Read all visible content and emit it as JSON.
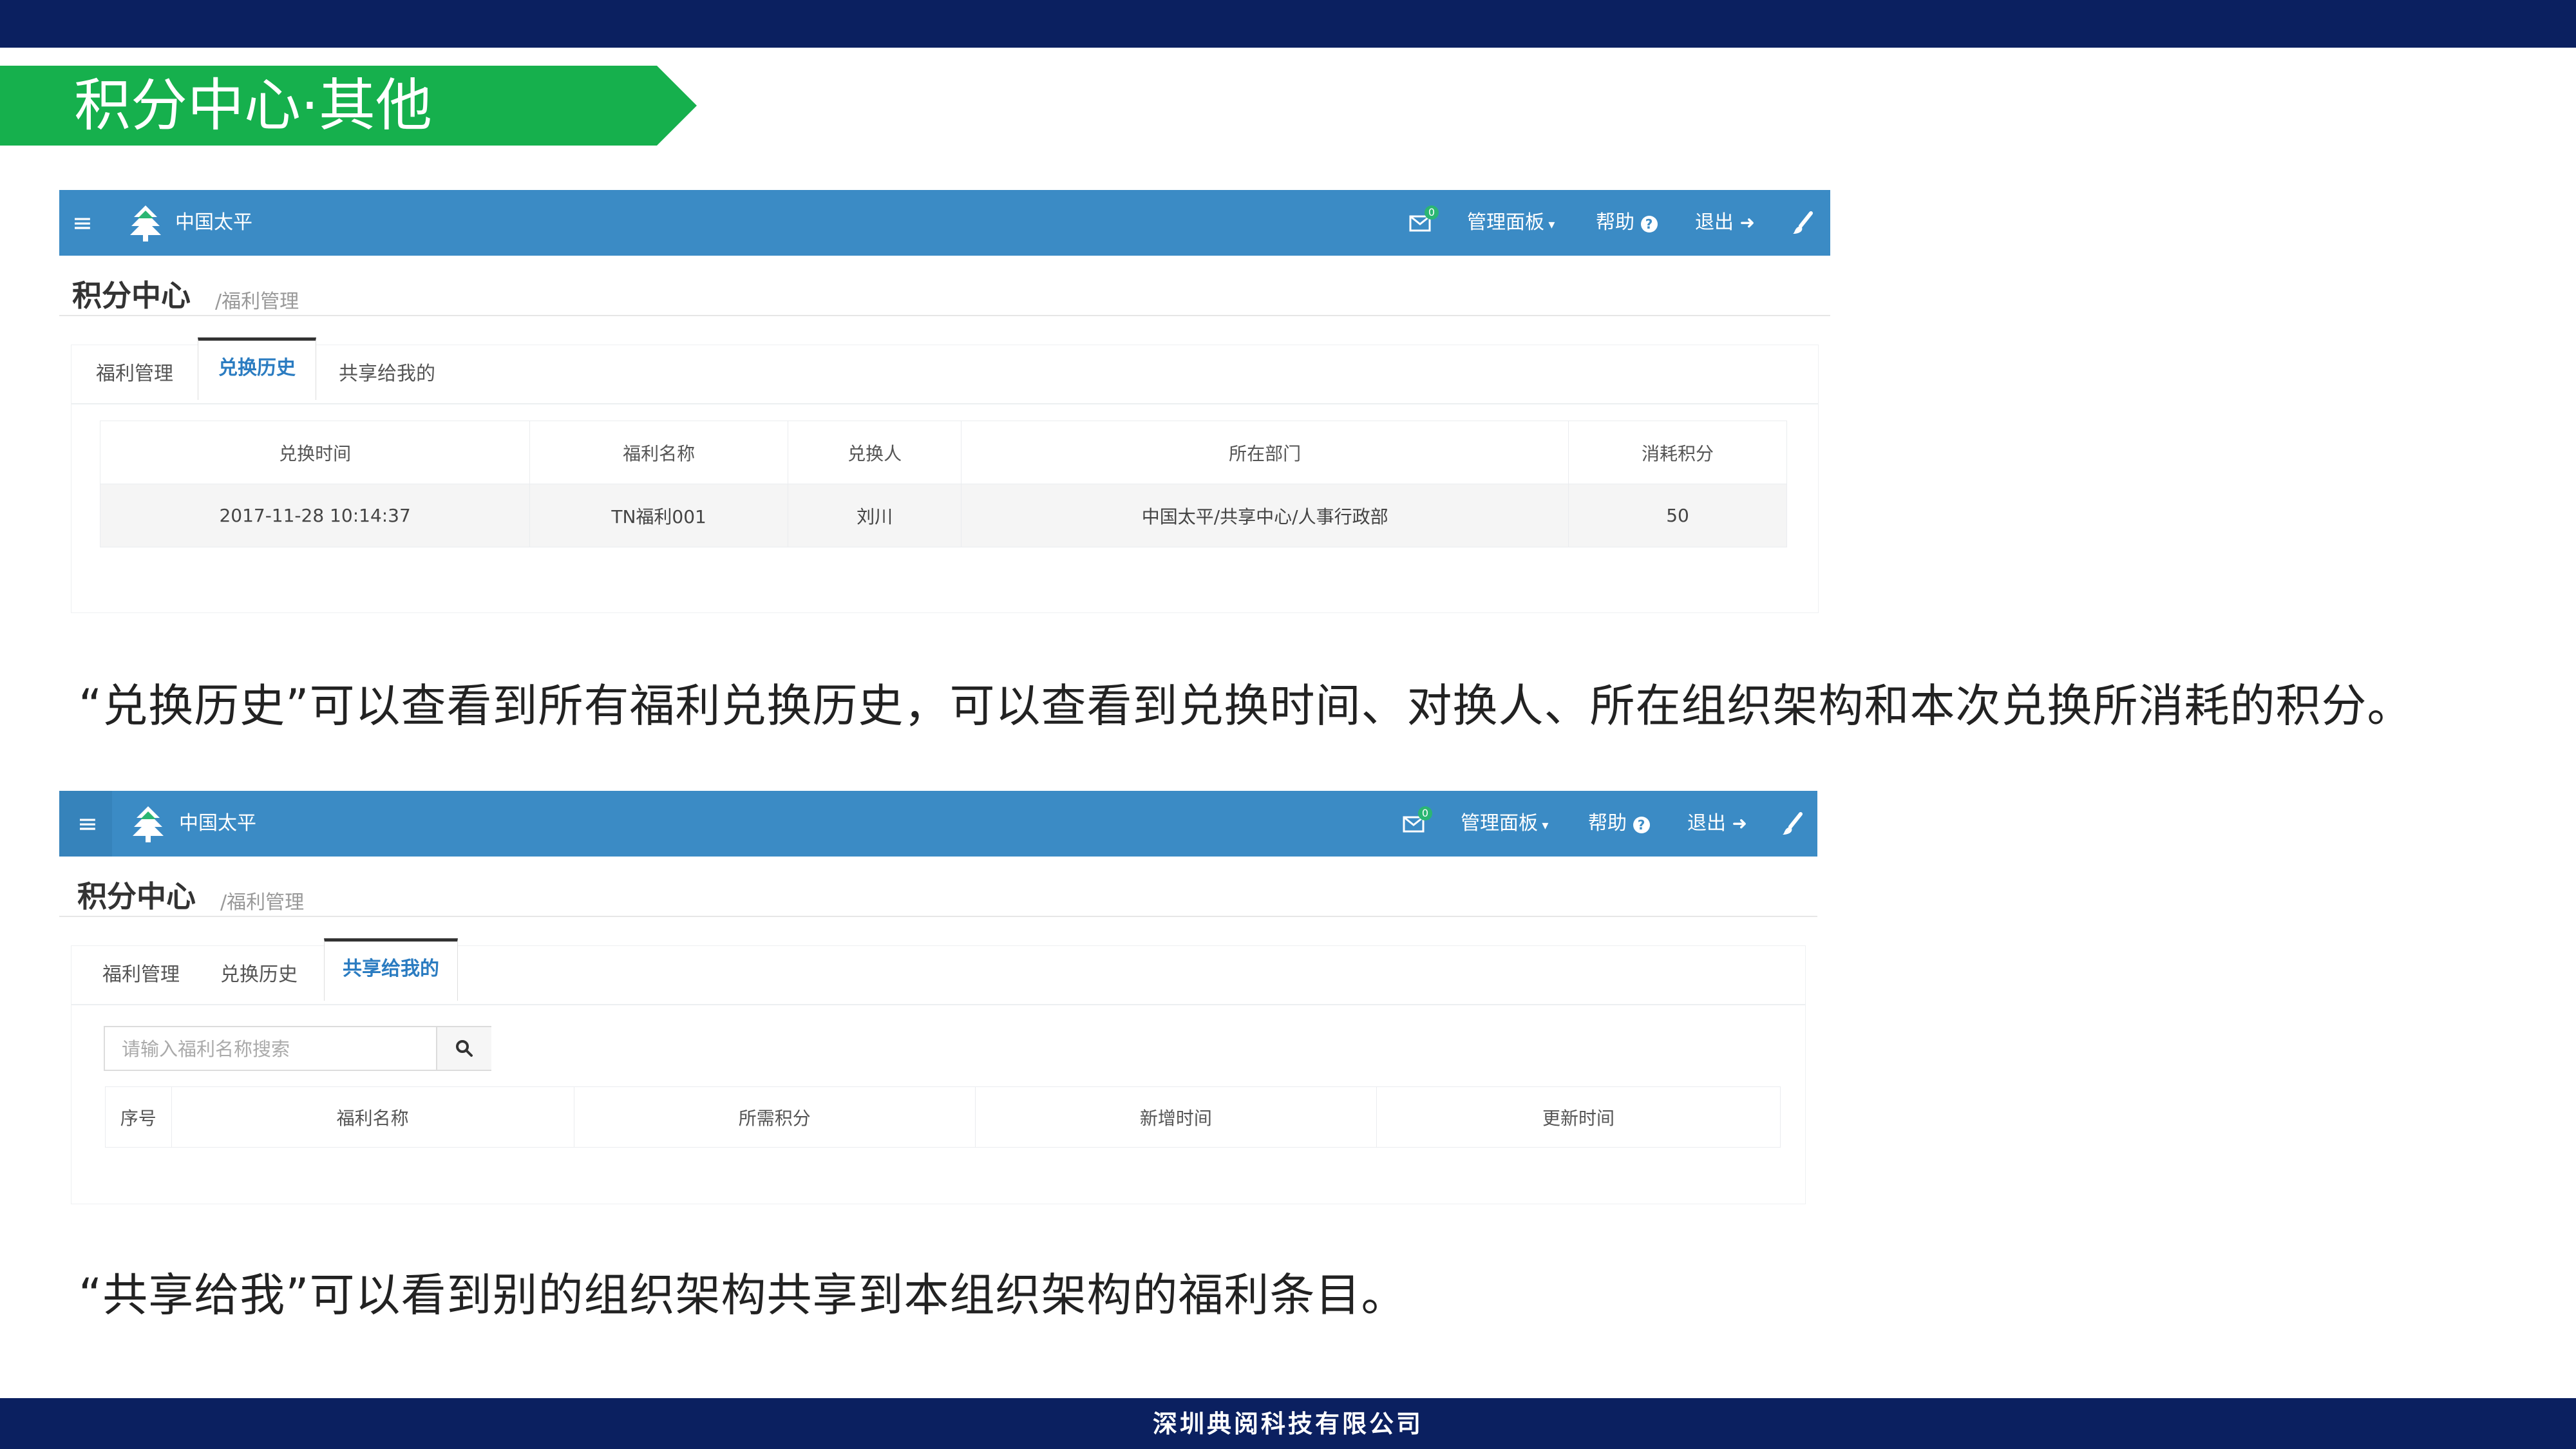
{
  "slide": {
    "title": "积分中心·其他",
    "description_1": "“兑换历史”可以查看到所有福利兑换历史，可以查看到兑换时间、对换人、所在组织架构和本次兑换所消耗的积分。",
    "description_2": "“共享给我”可以看到别的组织架构共享到本组织架构的福利条目。",
    "company": "深圳典阅科技有限公司"
  },
  "colors": {
    "navbar": "#3b8bc5",
    "slide_bar": "#0b2060",
    "title_banner": "#16b04d",
    "active_tab": "#2b7cc1"
  },
  "app1": {
    "navbar": {
      "menu_icon": "≡",
      "brand": "中国太平",
      "mail_badge": "0",
      "admin": "管理面板",
      "help": "帮助",
      "logout": "退出"
    },
    "page_title": "积分中心",
    "page_subtitle": "/福利管理",
    "tabs": [
      "福利管理",
      "兑换历史",
      "共享给我的"
    ],
    "active_tab": "兑换历史",
    "columns": [
      "兑换时间",
      "福利名称",
      "兑换人",
      "所在部门",
      "消耗积分"
    ],
    "rows": [
      [
        "2017-11-28 10:14:37",
        "TN福利001",
        "刘川",
        "中国太平/共享中心/人事行政部",
        "50"
      ]
    ]
  },
  "app2": {
    "navbar": {
      "menu_icon": "≡",
      "brand": "中国太平",
      "mail_badge": "0",
      "admin": "管理面板",
      "help": "帮助",
      "logout": "退出"
    },
    "page_title": "积分中心",
    "page_subtitle": "/福利管理",
    "tabs": [
      "福利管理",
      "兑换历史",
      "共享给我的"
    ],
    "active_tab": "共享给我的",
    "search_placeholder": "请输入福利名称搜索",
    "columns": [
      "序号",
      "福利名称",
      "所需积分",
      "新增时间",
      "更新时间"
    ]
  }
}
